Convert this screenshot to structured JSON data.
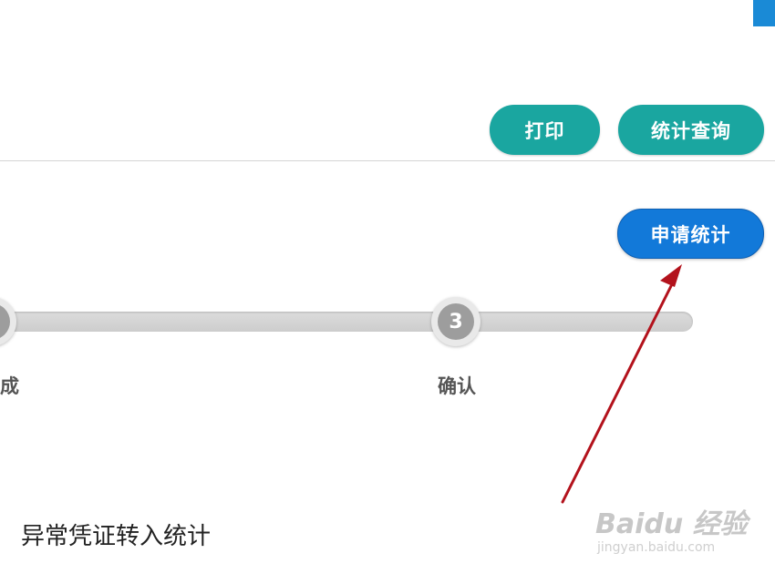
{
  "toolbar": {
    "print_label": "打印",
    "query_label": "统计查询"
  },
  "actions": {
    "apply_label": "申请统计"
  },
  "steps": [
    {
      "label": "完成",
      "number": ""
    },
    {
      "label": "确认",
      "number": "3"
    }
  ],
  "caption": "异常凭证转入统计",
  "watermark": {
    "brand": "Baidu 经验",
    "url": "jingyan.baidu.com"
  },
  "colors": {
    "teal_button": "#1aa6a0",
    "blue_button": "#1279d9",
    "annotation_arrow": "#b3121c"
  }
}
